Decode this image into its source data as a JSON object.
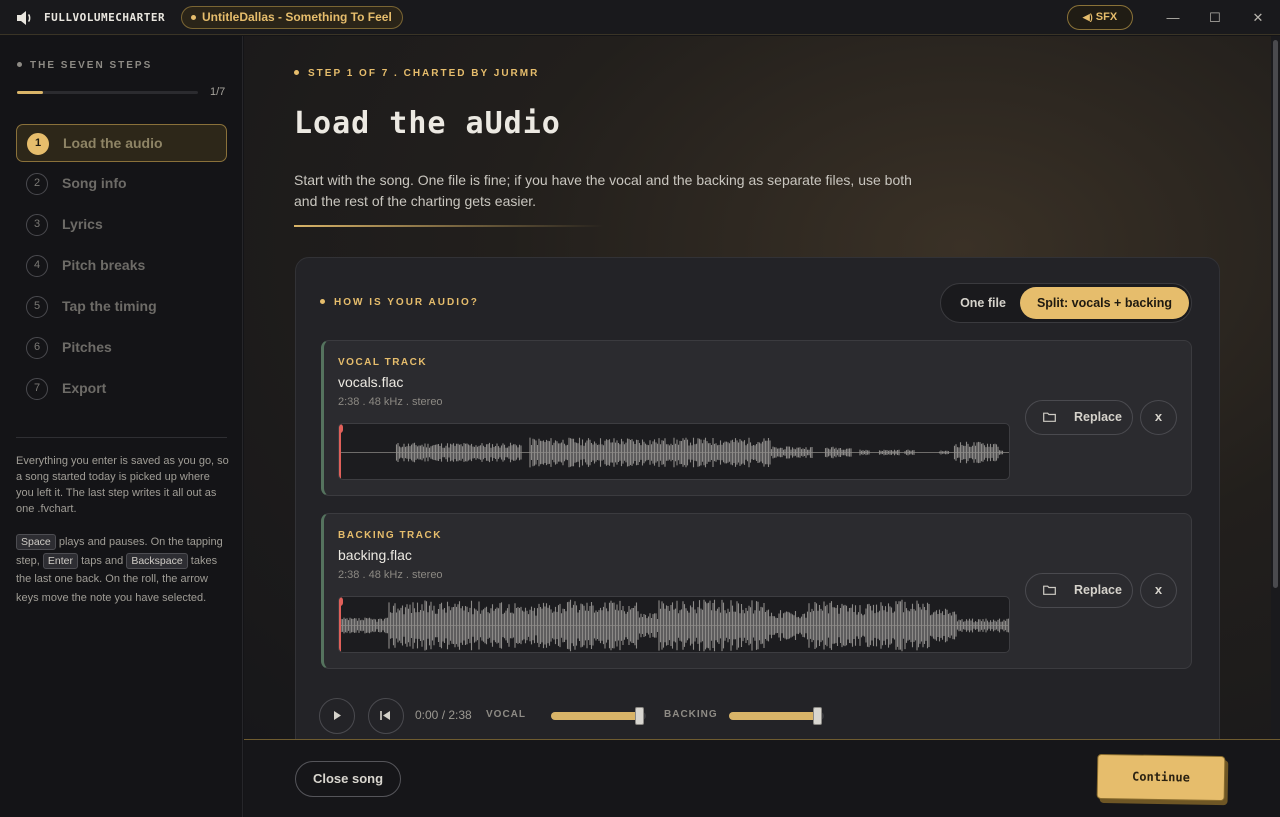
{
  "titlebar": {
    "brand": "FULLVOLUMECHARTER",
    "song_chip": "UntitleDallas - Something To Feel",
    "sfx_label": "SFX",
    "icons": [
      "speaker-icon",
      "minimize-icon",
      "maximize-icon",
      "close-icon"
    ]
  },
  "sidebar": {
    "heading": "THE SEVEN STEPS",
    "progress_text": "1/7",
    "progress_fraction": 0.143,
    "steps": [
      {
        "num": "1",
        "label": "Load the audio",
        "active": true
      },
      {
        "num": "2",
        "label": "Song info"
      },
      {
        "num": "3",
        "label": "Lyrics"
      },
      {
        "num": "4",
        "label": "Pitch breaks"
      },
      {
        "num": "5",
        "label": "Tap the timing"
      },
      {
        "num": "6",
        "label": "Pitches"
      },
      {
        "num": "7",
        "label": "Export"
      }
    ],
    "note1": "Everything you enter is saved as you go, so a song started today is picked up where you left it. The last step writes it all out as one .fvchart.",
    "keys": {
      "k1": "Space",
      "t1": " plays and pauses. On the tapping step, ",
      "k2": "Enter",
      "t2": " taps and ",
      "k3": "Backspace",
      "t3": " takes the last one back. On the roll, the arrow keys move the note you have selected."
    }
  },
  "main": {
    "eyebrow": "STEP 1 OF 7 . CHARTED BY JURMR",
    "title": "Load the aUdio",
    "intro": "Start with the song. One file is fine; if you have the vocal and the backing as separate files, use both and the rest of the charting gets easier.",
    "card": {
      "heading": "HOW IS YOUR AUDIO?",
      "options": {
        "one": "One file",
        "split": "Split: vocals + backing",
        "selected": "split"
      },
      "tracks": [
        {
          "label": "VOCAL TRACK",
          "file": "vocals.flac",
          "meta": "2:38 . 48 kHz . stereo",
          "replace": "Replace",
          "remove": "x"
        },
        {
          "label": "BACKING TRACK",
          "file": "backing.flac",
          "meta": "2:38 . 48 kHz . stereo",
          "replace": "Replace",
          "remove": "x"
        }
      ],
      "transport": {
        "time": "0:00 / 2:38",
        "vocal_label": "VOCAL",
        "backing_label": "BACKING",
        "vocal_level": 0.93,
        "backing_level": 0.93
      }
    }
  },
  "footer": {
    "close_label": "Close song",
    "continue_label": "Continue"
  },
  "colors": {
    "accent": "#e6bd6c",
    "background": "#141417",
    "card": "#232327",
    "playhead": "#e0605a",
    "waveform": "#8c8a88"
  }
}
